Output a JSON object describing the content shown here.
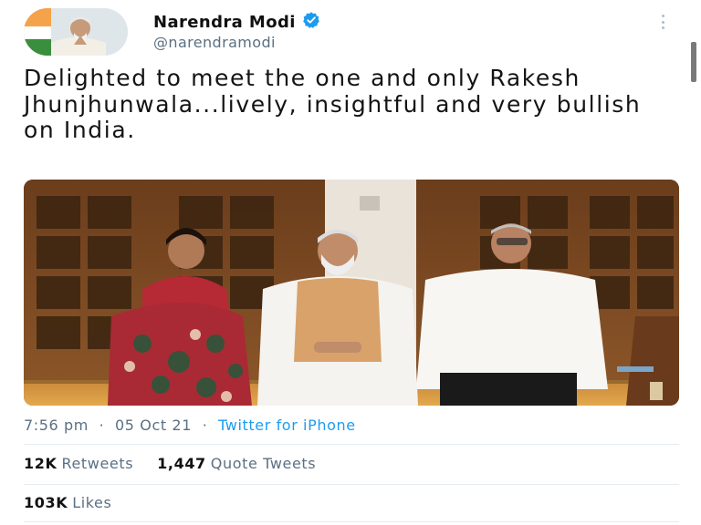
{
  "author": {
    "name": "Narendra Modi",
    "handle": "@narendramodi",
    "verified": true
  },
  "tweet": {
    "text": "Delighted to meet the one and only Rakesh Jhunjhunwala...lively, insightful and very bullish on India."
  },
  "meta": {
    "time": "7:56 pm",
    "date": "05 Oct 21",
    "separator": "·",
    "source": "Twitter for iPhone"
  },
  "stats": {
    "retweets_count": "12K",
    "retweets_label": "Retweets",
    "quotes_count": "1,447",
    "quotes_label": "Quote Tweets",
    "likes_count": "103K",
    "likes_label": "Likes"
  },
  "icons": {
    "verified": "verified-badge-icon",
    "more": "more-vertical-icon"
  },
  "colors": {
    "link": "#1d9bf0",
    "verified": "#1d9bf0",
    "secondary_text": "#5b7083"
  }
}
